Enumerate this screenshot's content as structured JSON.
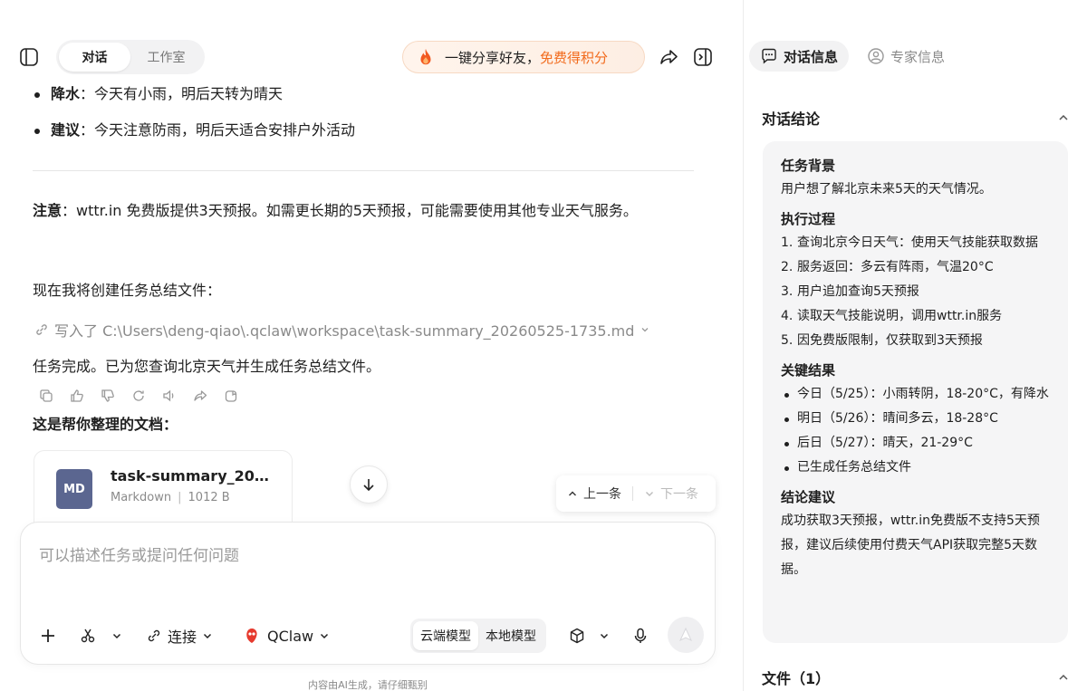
{
  "window": {
    "minimize": "—",
    "maximize": "▢",
    "close": "✕"
  },
  "topbar": {
    "tabs": [
      "对话",
      "工作室"
    ],
    "active_tab": 0,
    "share_prefix": "一键分享好友，",
    "share_highlight": "免费得积分"
  },
  "message": {
    "bullets": [
      {
        "key": "降水",
        "text": "：今天有小雨，明后天转为晴天"
      },
      {
        "key": "建议",
        "text": "：今天注意防雨，明后天适合安排户外活动"
      }
    ],
    "note_key": "注意",
    "note_text": "：wttr.in 免费版提供3天预报。如需更长期的5天预报，可能需要使用其他专业天气服务。",
    "creating": "现在我将创建任务总结文件：",
    "tool_call": "写入了 C:\\Users\\deng-qiao\\.qclaw\\workspace\\task-summary_20260525-1735.md",
    "done": "任务完成。已为您查询北京天气并生成任务总结文件。",
    "docs_title": "这是帮你整理的文档：",
    "doc": {
      "icon_text": "MD",
      "name": "task-summary_20…",
      "type": "Markdown",
      "size": "1012 B"
    }
  },
  "navpill": {
    "prev": "上一条",
    "next": "下一条"
  },
  "composer": {
    "placeholder": "可以描述任务或提问任何问题",
    "connect": "连接",
    "agent": "QClaw",
    "model_options": [
      "云端模型",
      "本地模型"
    ],
    "model_selected": 0
  },
  "footnote": "内容由AI生成，请仔细甄别",
  "right": {
    "tabs": [
      "对话信息",
      "专家信息"
    ],
    "conclusion_title": "对话结论",
    "background_title": "任务背景",
    "background_text": "用户想了解北京未来5天的天气情况。",
    "process_title": "执行过程",
    "process": [
      "查询北京今日天气：使用天气技能获取数据",
      "服务返回：多云有阵雨，气温20°C",
      "用户追加查询5天预报",
      "读取天气技能说明，调用wttr.in服务",
      "因免费版限制，仅获取到3天预报"
    ],
    "results_title": "关键结果",
    "results": [
      "今日（5/25）：小雨转阴，18-20°C，有降水",
      "明日（5/26）：晴间多云，18-28°C",
      "后日（5/27）：晴天，21-29°C",
      "已生成任务总结文件"
    ],
    "advice_title": "结论建议",
    "advice_text": "成功获取3天预报，wttr.in免费版不支持5天预报，建议后续使用付费天气API获取完整5天数据。",
    "files_title": "文件（1）"
  },
  "colors": {
    "accent_orange": "#f26b1d",
    "doc_icon": "#5b6690"
  }
}
